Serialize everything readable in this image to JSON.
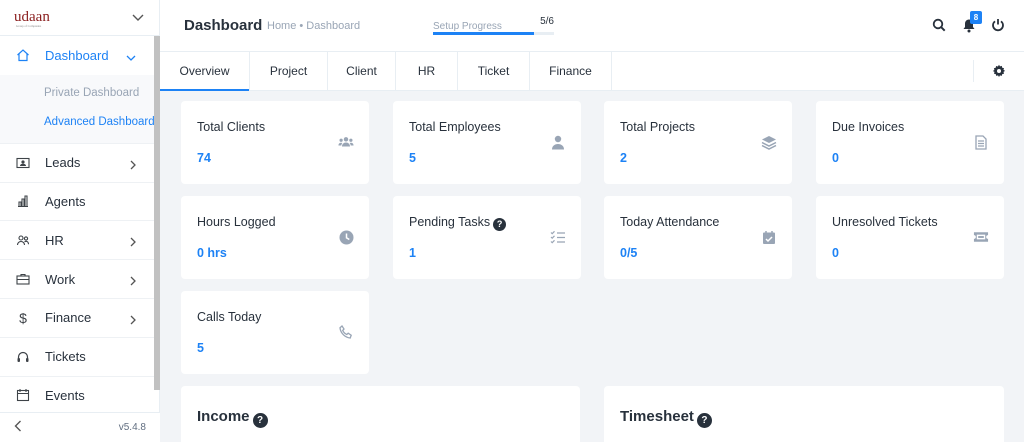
{
  "brand": {
    "logo_text": "udaan",
    "logo_sub": "Group of Companies"
  },
  "sidebar": {
    "items": [
      {
        "label": "Dashboard",
        "icon": "home-icon",
        "active": true,
        "submenu": [
          {
            "label": "Private Dashboard"
          },
          {
            "label": "Advanced Dashboard",
            "active": true
          }
        ]
      },
      {
        "label": "Leads",
        "icon": "contact-card-icon",
        "has_arrow": true
      },
      {
        "label": "Agents",
        "icon": "bar-chart-icon"
      },
      {
        "label": "HR",
        "icon": "people-icon",
        "has_arrow": true
      },
      {
        "label": "Work",
        "icon": "briefcase-icon",
        "has_arrow": true
      },
      {
        "label": "Finance",
        "icon": "dollar-icon",
        "has_arrow": true
      },
      {
        "label": "Tickets",
        "icon": "headset-icon"
      },
      {
        "label": "Events",
        "icon": "calendar-icon"
      }
    ],
    "version": "v5.4.8"
  },
  "header": {
    "title": "Dashboard",
    "breadcrumb": "Home • Dashboard",
    "setup_progress": {
      "label": "Setup Progress",
      "count": "5/6",
      "fraction": 0.833
    },
    "notification_count": "8"
  },
  "tabs": [
    {
      "label": "Overview",
      "active": true
    },
    {
      "label": "Project"
    },
    {
      "label": "Client"
    },
    {
      "label": "HR"
    },
    {
      "label": "Ticket"
    },
    {
      "label": "Finance"
    }
  ],
  "cards": [
    {
      "title": "Total Clients",
      "value": "74",
      "icon": "users-icon"
    },
    {
      "title": "Total Employees",
      "value": "5",
      "icon": "user-icon"
    },
    {
      "title": "Total Projects",
      "value": "2",
      "icon": "layers-icon"
    },
    {
      "title": "Due Invoices",
      "value": "0",
      "icon": "file-invoice-icon"
    },
    {
      "title": "Hours Logged",
      "value": "0 hrs",
      "icon": "clock-icon"
    },
    {
      "title": "Pending Tasks",
      "value": "1",
      "icon": "tasks-icon",
      "help": true
    },
    {
      "title": "Today Attendance",
      "value": "0/5",
      "icon": "calendar-check-icon"
    },
    {
      "title": "Unresolved Tickets",
      "value": "0",
      "icon": "ticket-icon"
    },
    {
      "title": "Calls Today",
      "value": "5",
      "icon": "phone-icon"
    }
  ],
  "sections": [
    {
      "title": "Income"
    },
    {
      "title": "Timesheet"
    }
  ],
  "colors": {
    "accent": "#1d82f5",
    "text": "#28313c",
    "muted": "#99a5b5",
    "background": "#f2f4f7"
  }
}
